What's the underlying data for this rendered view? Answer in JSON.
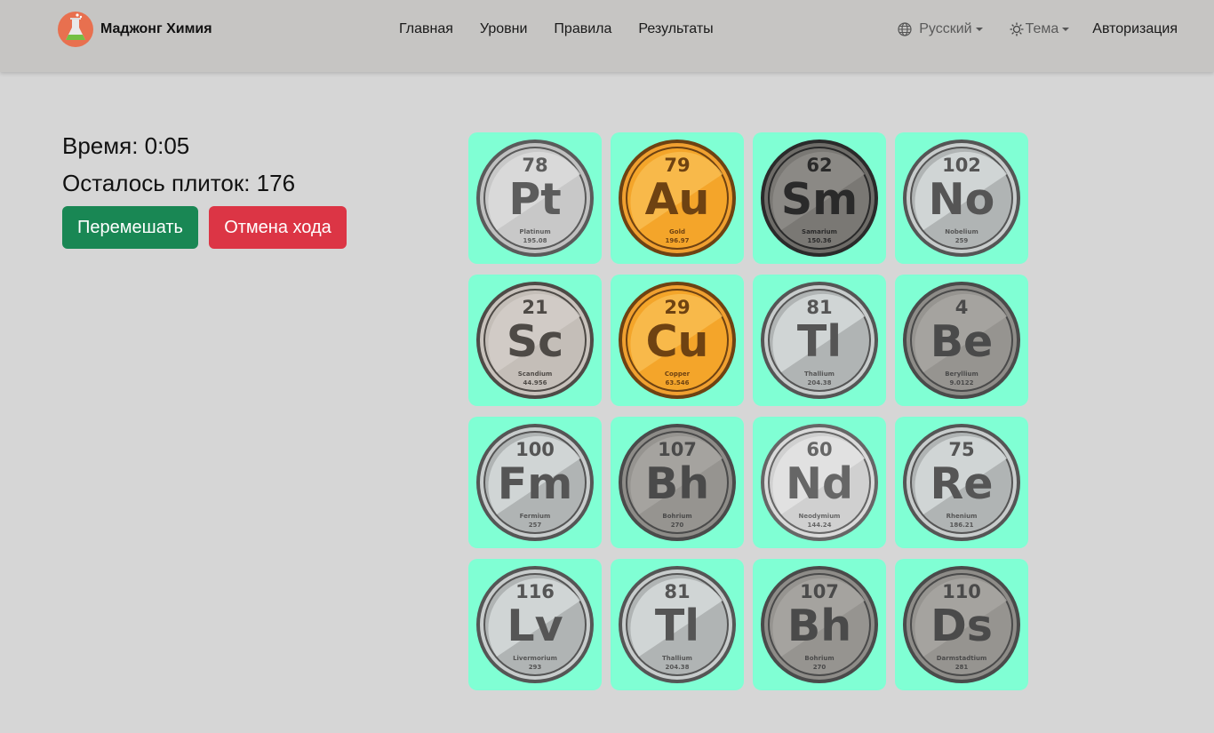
{
  "brand": {
    "name": "Маджонг Химия"
  },
  "nav": {
    "links": [
      "Главная",
      "Уровни",
      "Правила",
      "Результаты"
    ],
    "language": "Русский",
    "theme": "Тема",
    "login": "Авторизация"
  },
  "game": {
    "time_label": "Время: 0:05",
    "tiles_left_label": "Осталось плиток: 176",
    "shuffle_label": "Перемешать",
    "undo_label": "Отмена хода"
  },
  "colors": {
    "tile_bg": "#80ffd4",
    "shuffle": "#198754",
    "undo": "#dc3545"
  },
  "tiles": [
    {
      "number": "78",
      "symbol": "Pt",
      "name": "Platinum",
      "mass": "195.08",
      "style": "platinum"
    },
    {
      "number": "79",
      "symbol": "Au",
      "name": "Gold",
      "mass": "196.97",
      "style": "gold"
    },
    {
      "number": "62",
      "symbol": "Sm",
      "name": "Samarium",
      "mass": "150.36",
      "style": "dark"
    },
    {
      "number": "102",
      "symbol": "No",
      "name": "Nobelium",
      "mass": "259",
      "style": "silver"
    },
    {
      "number": "21",
      "symbol": "Sc",
      "name": "Scandium",
      "mass": "44.956",
      "style": "beige"
    },
    {
      "number": "29",
      "symbol": "Cu",
      "name": "Copper",
      "mass": "63.546",
      "style": "gold"
    },
    {
      "number": "81",
      "symbol": "Tl",
      "name": "Thallium",
      "mass": "204.38",
      "style": "silver"
    },
    {
      "number": "4",
      "symbol": "Be",
      "name": "Beryllium",
      "mass": "9.0122",
      "style": "gray"
    },
    {
      "number": "100",
      "symbol": "Fm",
      "name": "Fermium",
      "mass": "257",
      "style": "silver"
    },
    {
      "number": "107",
      "symbol": "Bh",
      "name": "Bohrium",
      "mass": "270",
      "style": "gray"
    },
    {
      "number": "60",
      "symbol": "Nd",
      "name": "Neodymium",
      "mass": "144.24",
      "style": "light"
    },
    {
      "number": "75",
      "symbol": "Re",
      "name": "Rhenium",
      "mass": "186.21",
      "style": "silver"
    },
    {
      "number": "116",
      "symbol": "Lv",
      "name": "Livermorium",
      "mass": "293",
      "style": "silver"
    },
    {
      "number": "81",
      "symbol": "Tl",
      "name": "Thallium",
      "mass": "204.38",
      "style": "silver"
    },
    {
      "number": "107",
      "symbol": "Bh",
      "name": "Bohrium",
      "mass": "270",
      "style": "gray"
    },
    {
      "number": "110",
      "symbol": "Ds",
      "name": "Darmstadtium",
      "mass": "281",
      "style": "gray"
    }
  ]
}
